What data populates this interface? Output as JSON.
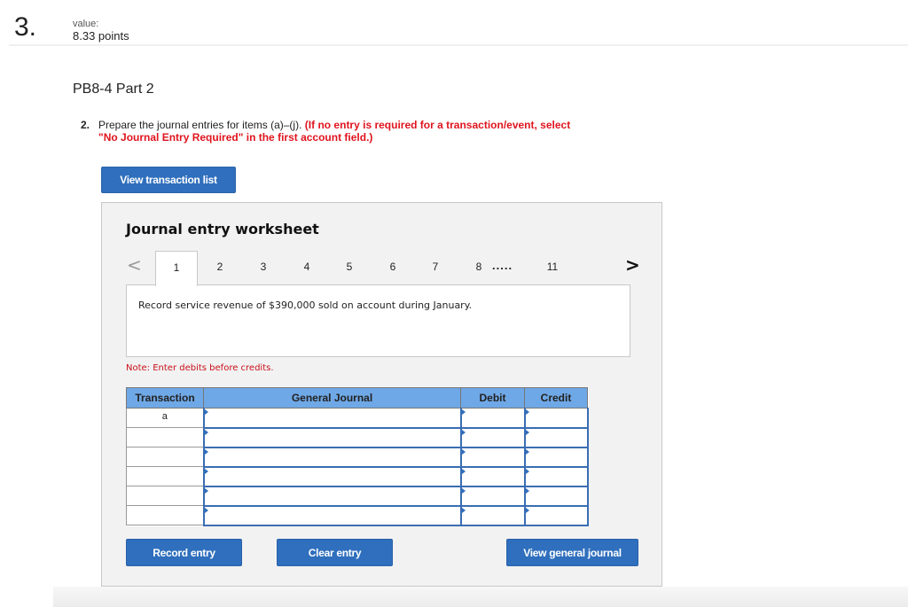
{
  "question": {
    "number": "3.",
    "value_label": "value:",
    "value": "8.33 points"
  },
  "part_title": "PB8-4 Part 2",
  "instruction": {
    "number": "2.",
    "text_plain": "Prepare the journal entries for items (a)–(j).",
    "text_red_1": "(If no entry is required for a transaction/event, select",
    "text_red_2": "\"No Journal Entry Required\" in the first account field.)"
  },
  "buttons": {
    "view_transaction_list": "View transaction list",
    "record_entry": "Record entry",
    "clear_entry": "Clear entry",
    "view_general_journal": "View general journal"
  },
  "worksheet": {
    "title": "Journal entry worksheet",
    "pager": {
      "prev": "<",
      "next": ">",
      "tabs": [
        "1",
        "2",
        "3",
        "4",
        "5",
        "6",
        "7",
        "8",
        "11"
      ],
      "active": "1",
      "ellipsis": "....."
    },
    "description": "Record service revenue of $390,000 sold on account during January.",
    "note": "Note: Enter debits before credits.",
    "table": {
      "headers": [
        "Transaction",
        "General Journal",
        "Debit",
        "Credit"
      ],
      "rows": [
        {
          "transaction": "a",
          "account": "",
          "debit": "",
          "credit": ""
        },
        {
          "transaction": "",
          "account": "",
          "debit": "",
          "credit": ""
        },
        {
          "transaction": "",
          "account": "",
          "debit": "",
          "credit": ""
        },
        {
          "transaction": "",
          "account": "",
          "debit": "",
          "credit": ""
        },
        {
          "transaction": "",
          "account": "",
          "debit": "",
          "credit": ""
        },
        {
          "transaction": "",
          "account": "",
          "debit": "",
          "credit": ""
        }
      ]
    }
  },
  "colors": {
    "accent_blue": "#2f6fbd",
    "header_blue": "#6fa8e6",
    "warning_red": "#e0141e"
  }
}
